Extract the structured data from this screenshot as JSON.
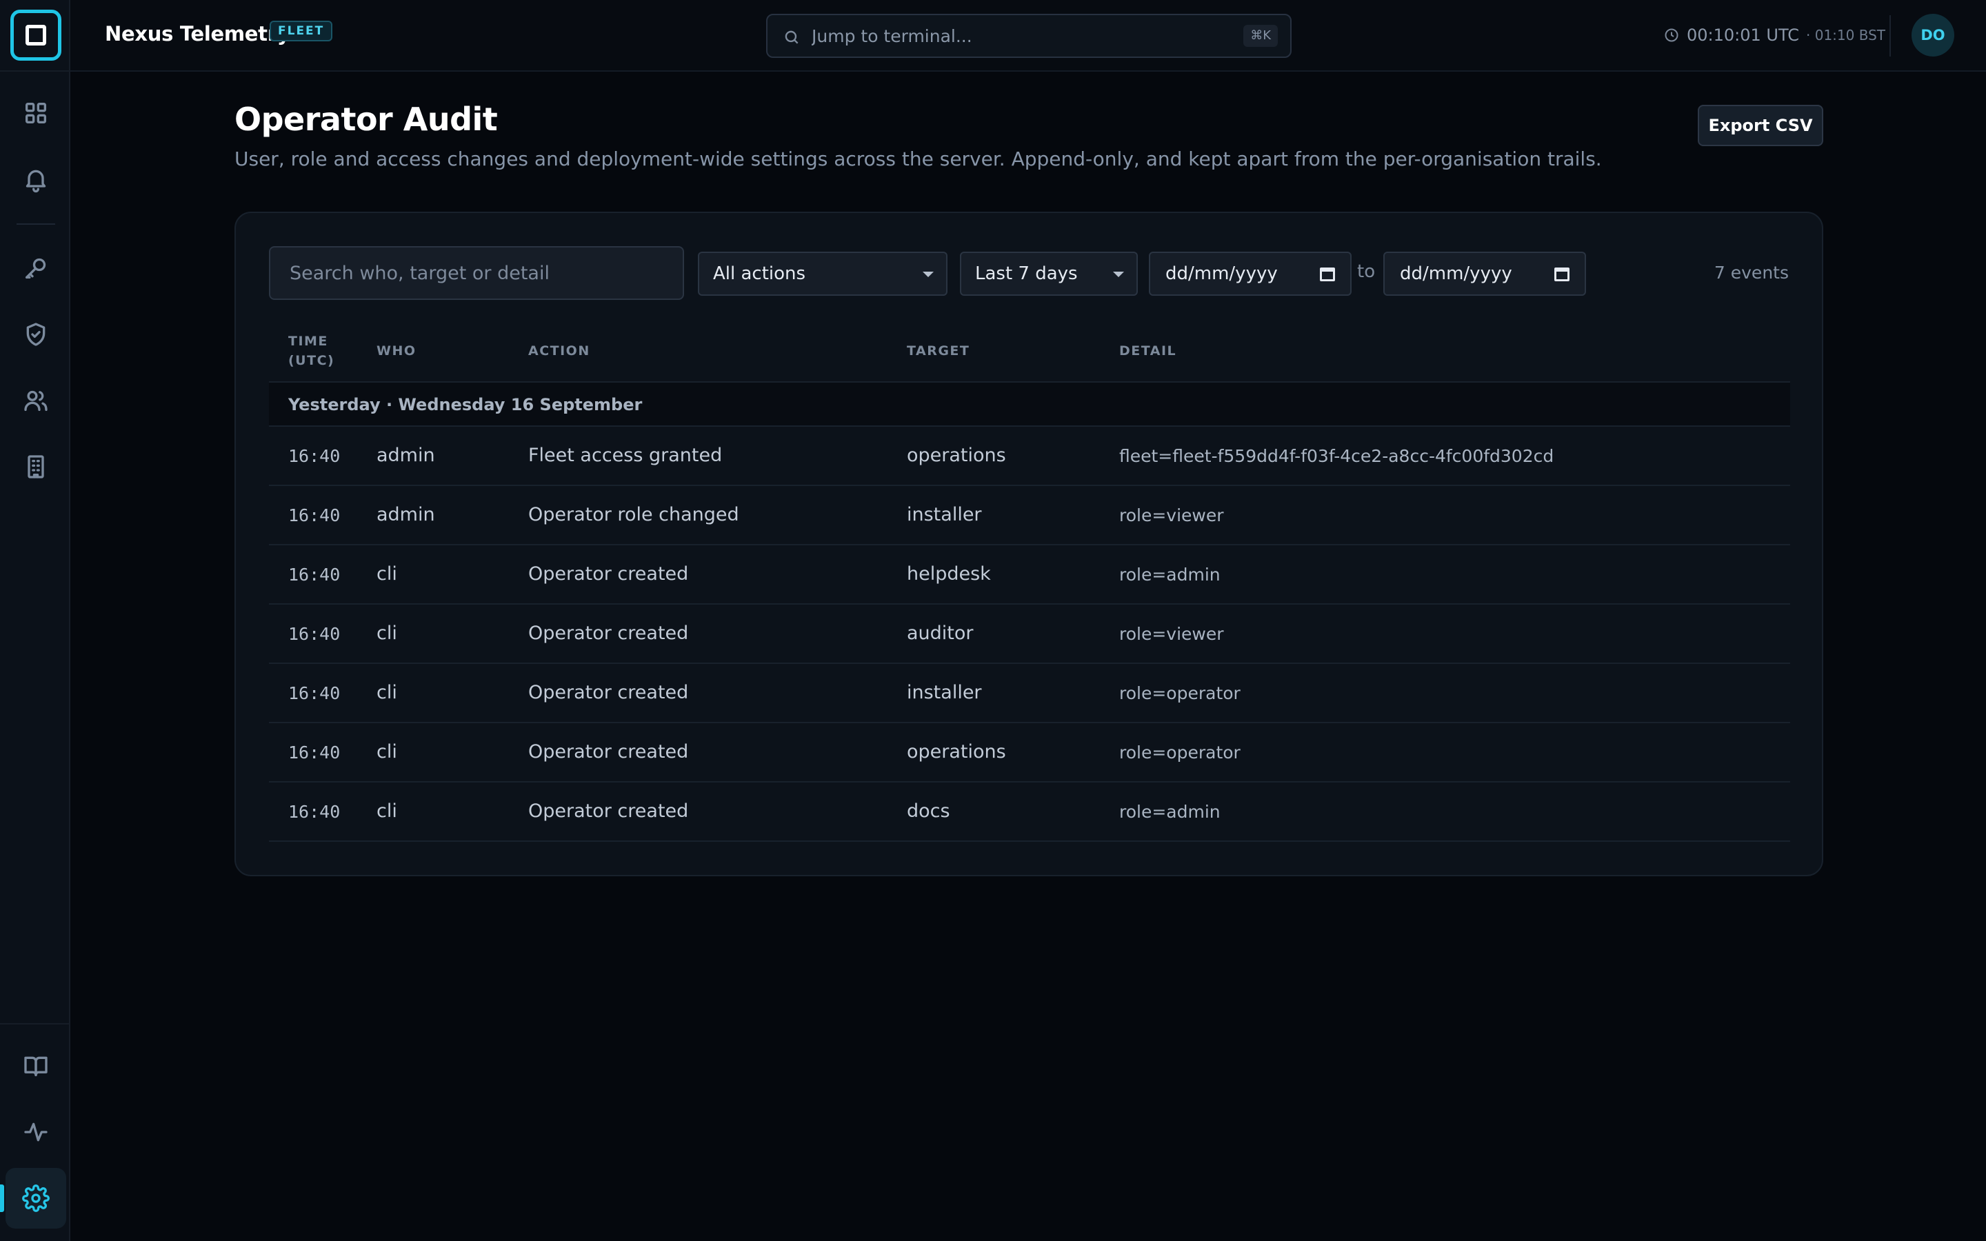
{
  "app": {
    "title": "Nexus Telemetry",
    "badge": "FLEET",
    "accent": "#1fc5e6"
  },
  "search": {
    "placeholder": "Jump to terminal...",
    "shortcut": "⌘K"
  },
  "clock": {
    "main": "00:10:01 UTC",
    "sub": "· 01:10 BST"
  },
  "user": {
    "initials": "DO"
  },
  "sidebar": {
    "items": [
      {
        "name": "dashboard",
        "icon": "grid-icon"
      },
      {
        "name": "alerts",
        "icon": "bell-icon"
      },
      {
        "name": "keys",
        "icon": "key-icon"
      },
      {
        "name": "security",
        "icon": "shield-check-icon"
      },
      {
        "name": "users",
        "icon": "users-icon"
      },
      {
        "name": "organisations",
        "icon": "building-icon"
      },
      {
        "name": "docs",
        "icon": "book-icon"
      },
      {
        "name": "activity",
        "icon": "pulse-icon"
      },
      {
        "name": "settings",
        "icon": "gear-icon",
        "active": true
      }
    ]
  },
  "page": {
    "title": "Operator Audit",
    "subtitle": "User, role and access changes and deployment-wide settings across the server. Append-only, and kept apart from the per-organisation trails.",
    "export_label": "Export CSV"
  },
  "filters": {
    "search_placeholder": "Search who, target or detail",
    "action_value": "All actions",
    "range_value": "Last 7 days",
    "from_placeholder": "dd/mm/yyyy",
    "to_label": "to",
    "to_placeholder": "dd/mm/yyyy",
    "count": "7 events"
  },
  "table": {
    "columns": {
      "time": "TIME (UTC)",
      "who": "WHO",
      "action": "ACTION",
      "target": "TARGET",
      "detail": "DETAIL"
    },
    "group_label": "Yesterday · Wednesday 16 September",
    "rows": [
      {
        "time": "16:40",
        "who": "admin",
        "action": "Fleet access granted",
        "target": "operations",
        "detail": "fleet=fleet-f559dd4f-f03f-4ce2-a8cc-4fc00fd302cd"
      },
      {
        "time": "16:40",
        "who": "admin",
        "action": "Operator role changed",
        "target": "installer",
        "detail": "role=viewer"
      },
      {
        "time": "16:40",
        "who": "cli",
        "action": "Operator created",
        "target": "helpdesk",
        "detail": "role=admin"
      },
      {
        "time": "16:40",
        "who": "cli",
        "action": "Operator created",
        "target": "auditor",
        "detail": "role=viewer"
      },
      {
        "time": "16:40",
        "who": "cli",
        "action": "Operator created",
        "target": "installer",
        "detail": "role=operator"
      },
      {
        "time": "16:40",
        "who": "cli",
        "action": "Operator created",
        "target": "operations",
        "detail": "role=operator"
      },
      {
        "time": "16:40",
        "who": "cli",
        "action": "Operator created",
        "target": "docs",
        "detail": "role=admin"
      }
    ]
  }
}
